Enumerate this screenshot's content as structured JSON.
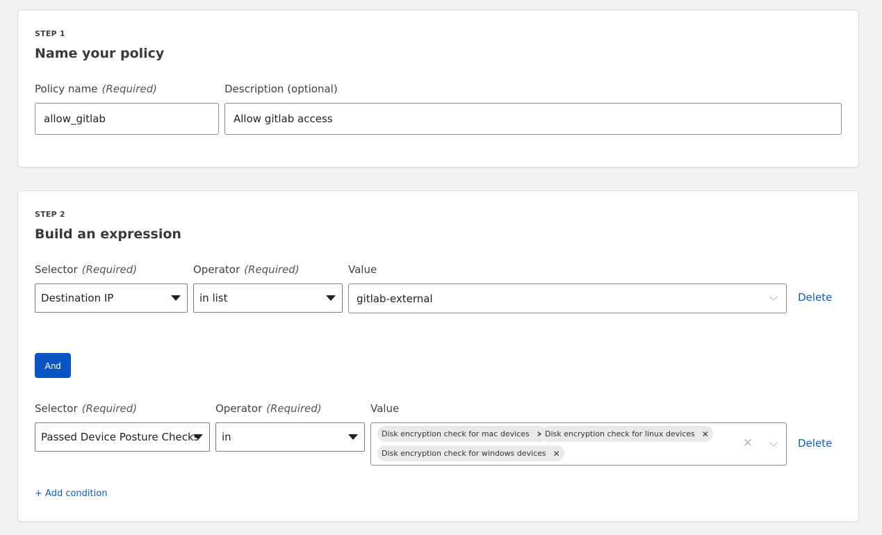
{
  "step1": {
    "step_label": "STEP 1",
    "title": "Name your policy",
    "policy_name_label": "Policy name",
    "required_text": "(Required)",
    "policy_name_value": "allow_gitlab",
    "description_label": "Description (optional)",
    "description_value": "Allow gitlab access"
  },
  "step2": {
    "step_label": "STEP 2",
    "title": "Build an expression",
    "and_button": "And",
    "add_condition": "+ Add condition",
    "conditions": [
      {
        "selector_label": "Selector",
        "operator_label": "Operator",
        "value_label": "Value",
        "required_text": "(Required)",
        "selector_value": "Destination IP",
        "operator_value": "in list",
        "value": "gitlab-external",
        "delete": "Delete"
      },
      {
        "selector_label": "Selector",
        "operator_label": "Operator",
        "value_label": "Value",
        "required_text": "(Required)",
        "selector_value": "Passed Device Posture Checks",
        "operator_value": "in",
        "chips": [
          "Disk encryption check for mac devices",
          "Disk encryption check for linux devices",
          "Disk encryption check for windows devices"
        ],
        "delete": "Delete"
      }
    ]
  },
  "icons": {
    "caret": "caret-down-icon",
    "chevron": "chevron-down-icon",
    "clear": "clear-icon",
    "chip_remove": "chip-remove-icon"
  },
  "colors": {
    "accent": "#0a55c6",
    "link": "#0b5fc4",
    "background": "#f2f2f2",
    "chip": "#e9e9e9"
  }
}
